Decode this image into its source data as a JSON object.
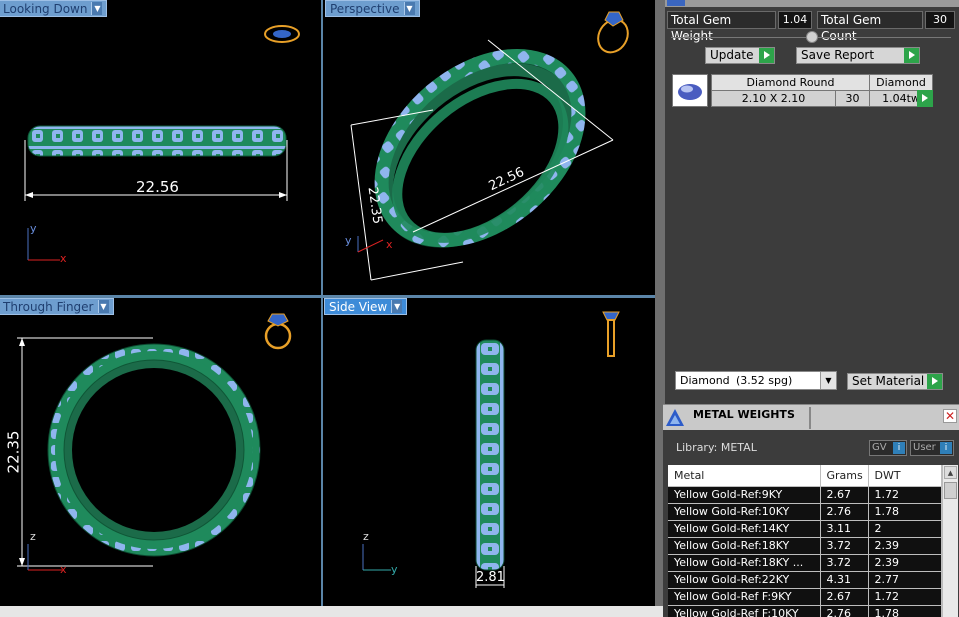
{
  "viewports": {
    "top_left": {
      "label": "Looking Down",
      "dimension": "22.56",
      "axes": [
        "y",
        "x"
      ]
    },
    "top_right": {
      "label": "Perspective",
      "dimension_a": "22.56",
      "dimension_b": "22.35",
      "axes": [
        "y",
        "x"
      ]
    },
    "bottom_left": {
      "label": "Through Finger",
      "dimension": "22.35",
      "axes": [
        "z",
        "x"
      ]
    },
    "bottom_right": {
      "label": "Side View",
      "dimension": "2.81",
      "axes": [
        "z",
        "y"
      ]
    }
  },
  "gems": {
    "total_weight_label": "Total Gem Weight",
    "total_weight_value": "1.04",
    "total_count_label": "Total Gem Count",
    "total_count_value": "30",
    "update_label": "Update",
    "save_report_label": "Save Report",
    "list": [
      {
        "shape": "Diamond Round",
        "material": "Diamond",
        "size": "2.10 X 2.10",
        "count": "30",
        "weight": "1.04tw"
      }
    ]
  },
  "material": {
    "selected": "Diamond",
    "spg": "(3.52 spg)",
    "set_label": "Set Material"
  },
  "metal_weights": {
    "title": "METAL WEIGHTS",
    "library_label": "Library: METAL",
    "gv_label": "GV",
    "user_label": "User",
    "columns": [
      "Metal",
      "Grams",
      "DWT"
    ],
    "rows": [
      [
        "Yellow Gold-Ref:9KY",
        "2.67",
        "1.72"
      ],
      [
        "Yellow Gold-Ref:10KY",
        "2.76",
        "1.78"
      ],
      [
        "Yellow Gold-Ref:14KY",
        "3.11",
        "2"
      ],
      [
        "Yellow Gold-Ref:18KY",
        "3.72",
        "2.39"
      ],
      [
        "Yellow Gold-Ref:18KY ...",
        "3.72",
        "2.39"
      ],
      [
        "Yellow Gold-Ref:22KY",
        "4.31",
        "2.77"
      ],
      [
        "Yellow Gold-Ref F:9KY",
        "2.67",
        "1.72"
      ],
      [
        "Yellow Gold-Ref F:10KY",
        "2.76",
        "1.78"
      ]
    ]
  },
  "colors": {
    "ring_green": "#1f8a5c",
    "gem_blue": "#8fb5ee",
    "dim_white": "#ffffff",
    "ring_icon_orange": "#e8a028"
  }
}
